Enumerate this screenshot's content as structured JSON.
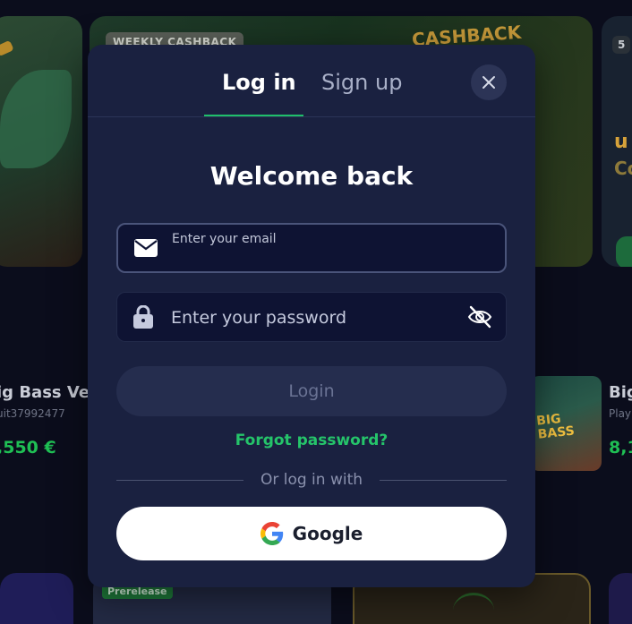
{
  "background": {
    "promo_badge": "WEEKLY CASHBACK",
    "promo_logo": "CASHBACK",
    "right_tile_number": "5",
    "right_tile_text_1": "u",
    "right_tile_text_2": "Co",
    "left_game": {
      "title": "ig Bass Veg",
      "subtitle": "uit37992477",
      "prize": ",550 €"
    },
    "right_game": {
      "title": "Big",
      "subtitle": "Play",
      "prize": "8,1"
    },
    "bass_tile_logo": "BIG BASS",
    "prerelease_tag": "Prerelease"
  },
  "modal": {
    "tabs": [
      {
        "label": "Log in",
        "active": true
      },
      {
        "label": "Sign up",
        "active": false
      }
    ],
    "close_icon": "close-icon",
    "title": "Welcome back",
    "email": {
      "placeholder": "Enter your email",
      "value": "",
      "icon": "envelope-icon"
    },
    "password": {
      "placeholder": "Enter your password",
      "value": "",
      "icon": "lock-icon",
      "toggle_icon": "eye-off-icon"
    },
    "login_label": "Login",
    "forgot_label": "Forgot password?",
    "divider_text": "Or log in with",
    "google_label": "Google"
  },
  "colors": {
    "accent_green": "#25c46a",
    "modal_bg": "#1a2140",
    "field_bg": "#0e1333"
  }
}
